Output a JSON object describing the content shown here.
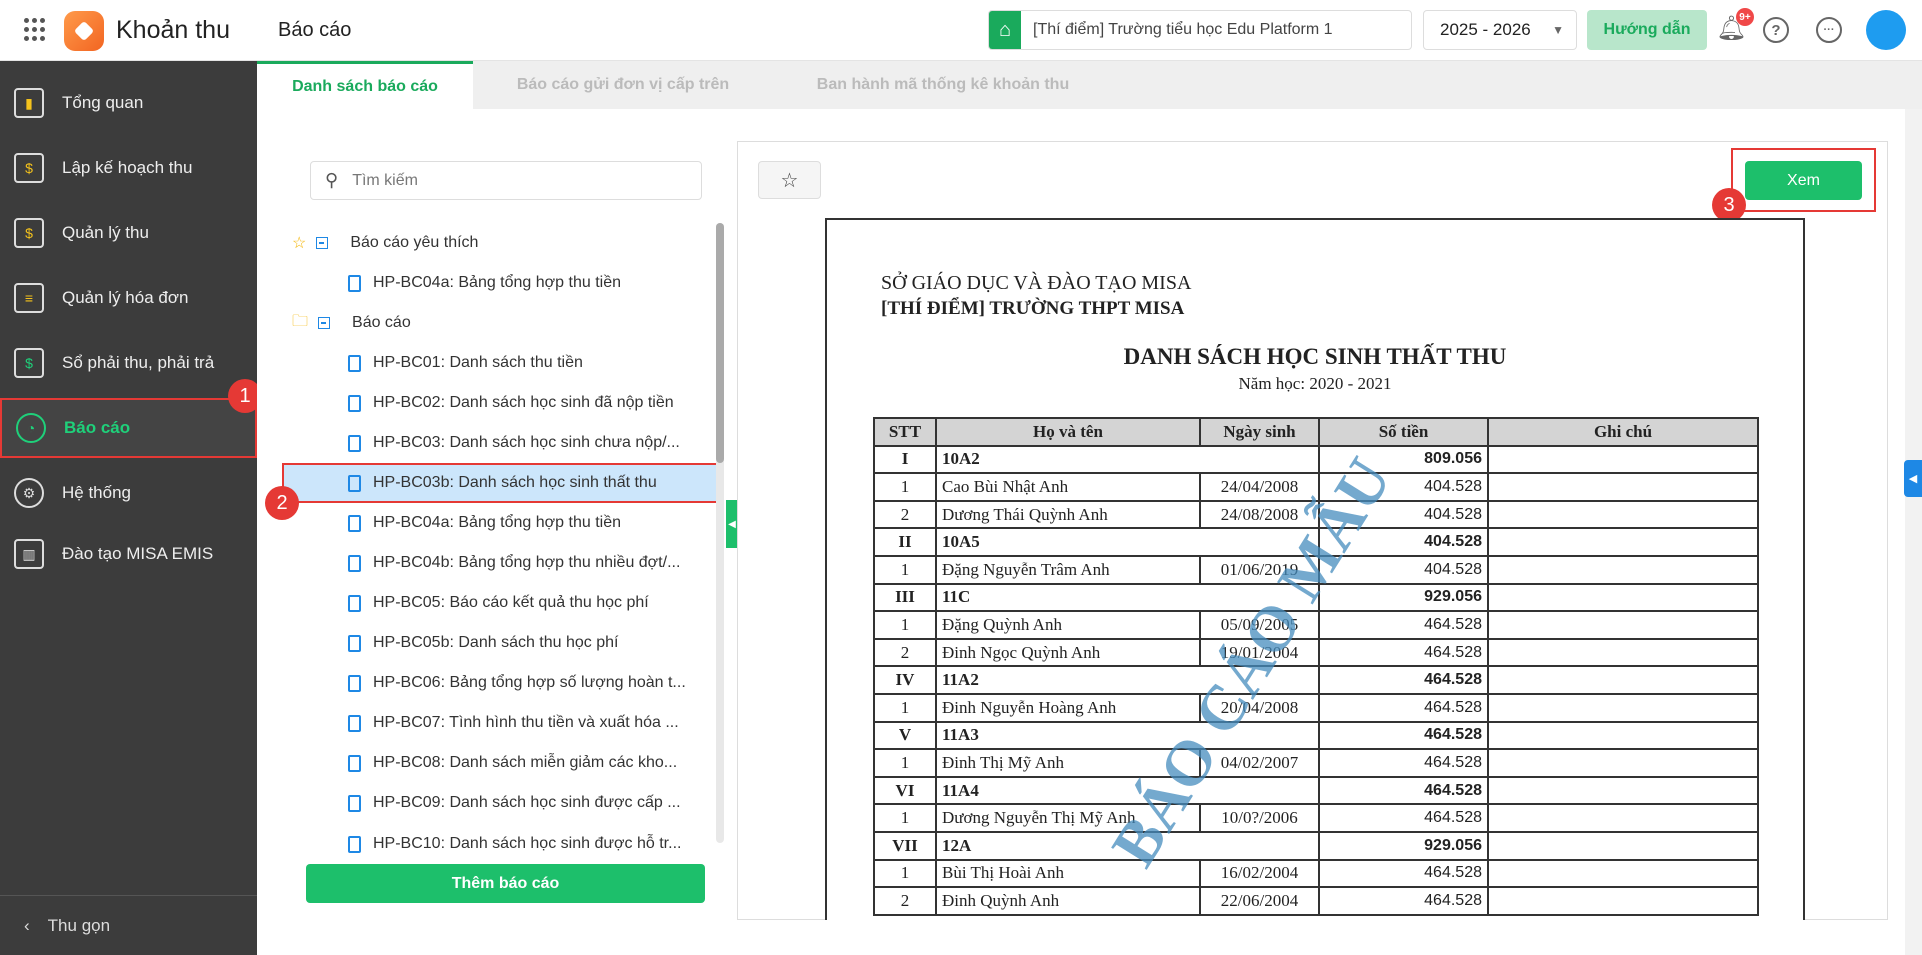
{
  "header": {
    "app_title": "Khoản thu",
    "page_title": "Báo cáo",
    "school": "[Thí điểm] Trường tiểu học Edu Platform 1",
    "year": "2025 - 2026",
    "guide_label": "Hướng dẫn",
    "notification_badge": "9+",
    "help": "?",
    "more": "···"
  },
  "sidebar": {
    "items": [
      {
        "label": "Tổng quan",
        "icon": "bar-chart-icon"
      },
      {
        "label": "Lập kế hoạch thu",
        "icon": "calendar-dollar-icon"
      },
      {
        "label": "Quản lý thu",
        "icon": "money-hand-icon"
      },
      {
        "label": "Quản lý hóa đơn",
        "icon": "invoice-icon"
      },
      {
        "label": "Sổ phải thu, phải trả",
        "icon": "ledger-icon"
      },
      {
        "label": "Báo cáo",
        "icon": "pie-chart-icon",
        "active": true
      },
      {
        "label": "Hệ thống",
        "icon": "gear-icon"
      },
      {
        "label": "Đào tạo MISA EMIS",
        "icon": "book-icon"
      }
    ],
    "collapse_label": "Thu gọn"
  },
  "tabs": [
    {
      "label": "Danh sách báo cáo",
      "active": true
    },
    {
      "label": "Báo cáo gửi đơn vị cấp trên"
    },
    {
      "label": "Ban hành mã thống kê khoản thu"
    }
  ],
  "report_list": {
    "search_placeholder": "Tìm kiếm",
    "favorites_label": "Báo cáo yêu thích",
    "favorites": [
      "HP-BC04a: Bảng tổng hợp thu tiền"
    ],
    "reports_label": "Báo cáo",
    "reports": [
      "HP-BC01: Danh sách thu tiền",
      "HP-BC02: Danh sách học sinh đã nộp tiền",
      "HP-BC03: Danh sách học sinh chưa nộp/...",
      "HP-BC03b: Danh sách học sinh thất thu",
      "HP-BC04a: Bảng tổng hợp thu tiền",
      "HP-BC04b: Bảng tổng hợp thu nhiều đợt/...",
      "HP-BC05: Báo cáo kết quả thu học phí",
      "HP-BC05b: Danh sách thu học phí",
      "HP-BC06: Bảng tổng hợp số lượng hoàn t...",
      "HP-BC07: Tình hình thu tiền và xuất hóa ...",
      "HP-BC08: Danh sách miễn giảm các kho...",
      "HP-BC09: Danh sách học sinh được cấp ...",
      "HP-BC10: Danh sách học sinh được hỗ tr..."
    ],
    "selected_index": 3,
    "add_label": "Thêm báo cáo"
  },
  "preview": {
    "view_label": "Xem",
    "org": "SỞ GIÁO DỤC VÀ ĐÀO TẠO MISA",
    "school": "[THÍ ĐIỂM] TRƯỜNG THPT MISA",
    "title": "DANH SÁCH HỌC SINH THẤT THU",
    "year": "Năm học: 2020 - 2021",
    "watermark": "BÁO CÁO MẪU",
    "columns": [
      "STT",
      "Họ và tên",
      "Ngày sinh",
      "Số tiền",
      "Ghi chú"
    ],
    "rows": [
      {
        "type": "group",
        "stt": "I",
        "name": "10A2",
        "amount": "809.056"
      },
      {
        "stt": "1",
        "name": "Cao Bùi Nhật Anh",
        "dob": "24/04/2008",
        "amount": "404.528"
      },
      {
        "stt": "2",
        "name": "Dương Thái Quỳnh Anh",
        "dob": "24/08/2008",
        "amount": "404.528"
      },
      {
        "type": "group",
        "stt": "II",
        "name": "10A5",
        "amount": "404.528"
      },
      {
        "stt": "1",
        "name": "Đặng Nguyễn Trâm Anh",
        "dob": "01/06/2019",
        "amount": "404.528"
      },
      {
        "type": "group",
        "stt": "III",
        "name": "11C",
        "amount": "929.056"
      },
      {
        "stt": "1",
        "name": "Đặng Quỳnh Anh",
        "dob": "05/09/2005",
        "amount": "464.528"
      },
      {
        "stt": "2",
        "name": "Đinh Ngọc Quỳnh Anh",
        "dob": "19/01/2004",
        "amount": "464.528"
      },
      {
        "type": "group",
        "stt": "IV",
        "name": "11A2",
        "amount": "464.528"
      },
      {
        "stt": "1",
        "name": "Đinh Nguyễn Hoàng Anh",
        "dob": "20/04/2008",
        "amount": "464.528"
      },
      {
        "type": "group",
        "stt": "V",
        "name": "11A3",
        "amount": "464.528"
      },
      {
        "stt": "1",
        "name": "Đinh Thị Mỹ Anh",
        "dob": "04/02/2007",
        "amount": "464.528"
      },
      {
        "type": "group",
        "stt": "VI",
        "name": "11A4",
        "amount": "464.528"
      },
      {
        "stt": "1",
        "name": "Dương Nguyễn Thị Mỹ Anh",
        "dob": "10/0?/2006",
        "amount": "464.528"
      },
      {
        "type": "group",
        "stt": "VII",
        "name": "12A",
        "amount": "929.056"
      },
      {
        "stt": "1",
        "name": "Bùi Thị Hoài Anh",
        "dob": "16/02/2004",
        "amount": "464.528"
      },
      {
        "stt": "2",
        "name": "Đinh Quỳnh Anh",
        "dob": "22/06/2004",
        "amount": "464.528"
      }
    ]
  },
  "step_badges": [
    "1",
    "2",
    "3"
  ],
  "colors": {
    "accent": "#1dbf6b",
    "sidebar_bg": "#3c3c3c",
    "highlight": "#e53935",
    "selected_row": "#cce6fb"
  }
}
